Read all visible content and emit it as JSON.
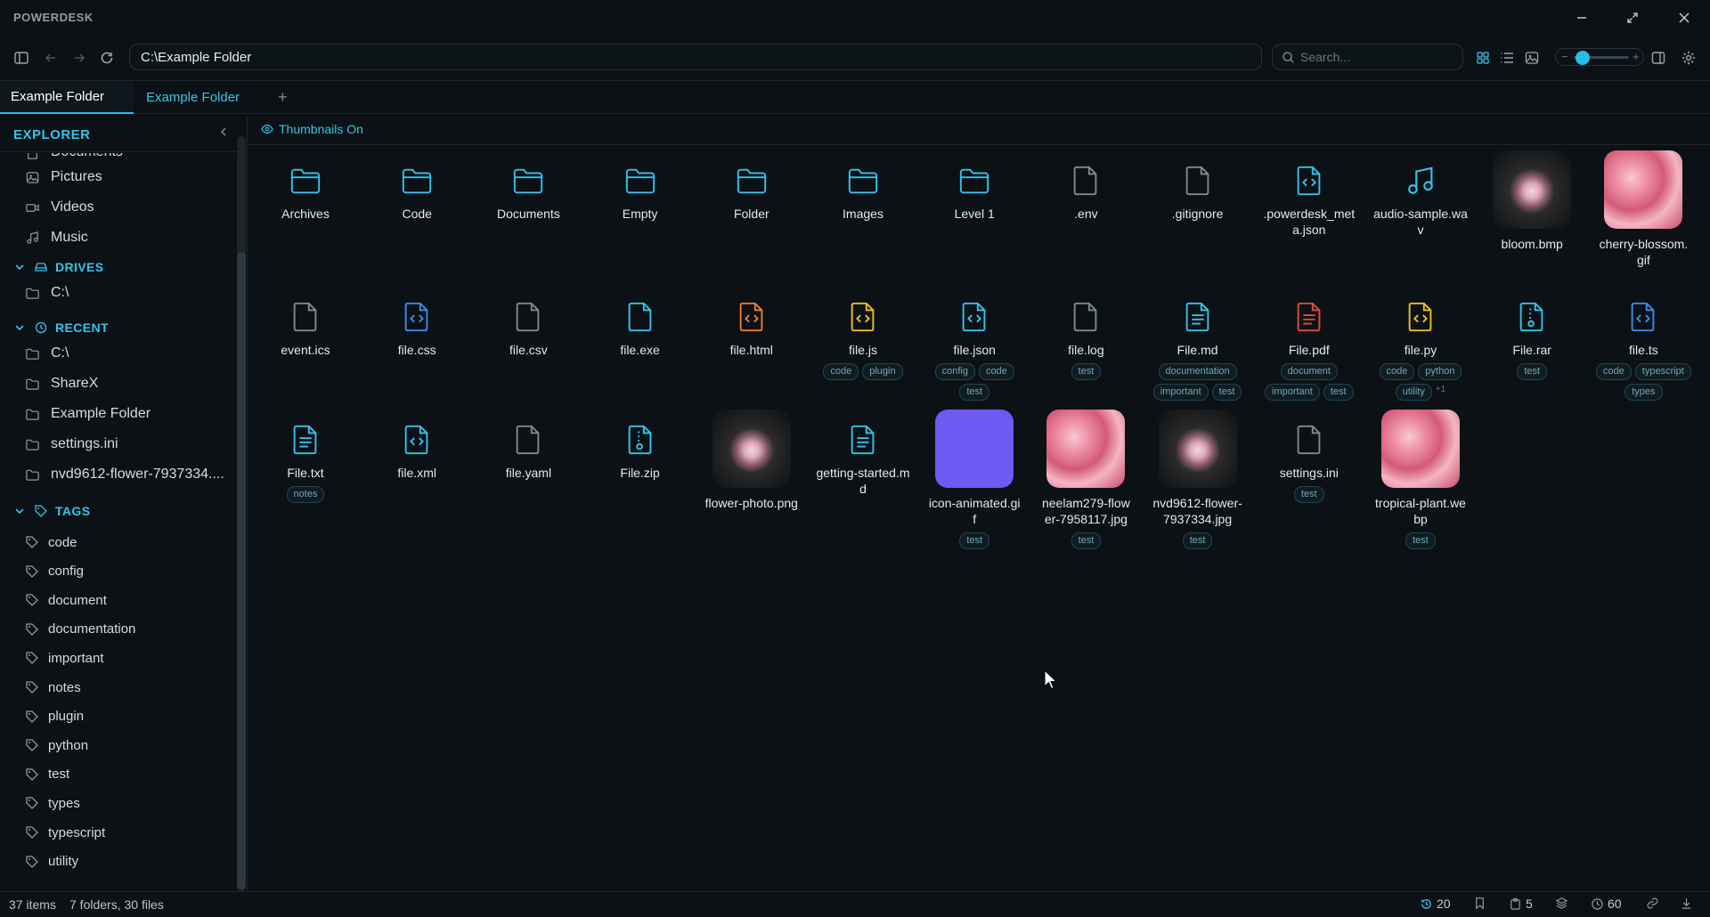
{
  "app": {
    "title": "POWERDESK"
  },
  "toolbar": {
    "address": "C:\\Example Folder",
    "search_placeholder": "Search..."
  },
  "tabs": [
    {
      "label": "Example Folder",
      "active": true
    },
    {
      "label": "Example Folder",
      "active": false
    }
  ],
  "sidebar": {
    "title": "EXPLORER",
    "partial_item": "Documents",
    "quick": [
      {
        "label": "Pictures",
        "icon": "image-icon"
      },
      {
        "label": "Videos",
        "icon": "video-icon"
      },
      {
        "label": "Music",
        "icon": "music-icon"
      }
    ],
    "drives_label": "DRIVES",
    "drives": [
      {
        "label": "C:\\"
      }
    ],
    "recent_label": "RECENT",
    "recent": [
      {
        "label": "C:\\"
      },
      {
        "label": "ShareX"
      },
      {
        "label": "Example Folder"
      },
      {
        "label": "settings.ini"
      },
      {
        "label": "nvd9612-flower-7937334...."
      }
    ],
    "tags_label": "TAGS",
    "tags": [
      "code",
      "config",
      "document",
      "documentation",
      "important",
      "notes",
      "plugin",
      "python",
      "test",
      "types",
      "typescript",
      "utility"
    ]
  },
  "main": {
    "thumbnails_label": "Thumbnails On",
    "items": [
      {
        "name": "Archives",
        "kind": "folder",
        "tags": []
      },
      {
        "name": "Code",
        "kind": "folder",
        "tags": []
      },
      {
        "name": "Documents",
        "kind": "folder",
        "tags": []
      },
      {
        "name": "Empty",
        "kind": "folder",
        "tags": []
      },
      {
        "name": "Folder",
        "kind": "folder",
        "tags": []
      },
      {
        "name": "Images",
        "kind": "folder",
        "tags": []
      },
      {
        "name": "Level 1",
        "kind": "folder",
        "tags": []
      },
      {
        "name": ".env",
        "kind": "file-gray",
        "tags": []
      },
      {
        "name": ".gitignore",
        "kind": "file-gray",
        "tags": []
      },
      {
        "name": ".powerdesk_meta.json",
        "kind": "code-cyan",
        "tags": []
      },
      {
        "name": "audio-sample.wav",
        "kind": "music",
        "tags": []
      },
      {
        "name": "bloom.bmp",
        "kind": "img-dark",
        "tags": []
      },
      {
        "name": "cherry-blossom.gif",
        "kind": "img-pink",
        "tags": []
      },
      {
        "name": "event.ics",
        "kind": "file-gray",
        "tags": []
      },
      {
        "name": "file.css",
        "kind": "code-blue",
        "tags": []
      },
      {
        "name": "file.csv",
        "kind": "file-gray",
        "tags": []
      },
      {
        "name": "file.exe",
        "kind": "file-cyan",
        "tags": []
      },
      {
        "name": "file.html",
        "kind": "code-orange",
        "tags": []
      },
      {
        "name": "file.js",
        "kind": "code-yellow",
        "tags": [
          "code",
          "plugin"
        ]
      },
      {
        "name": "file.json",
        "kind": "code-cyan",
        "tags": [
          "config",
          "code",
          "test"
        ]
      },
      {
        "name": "file.log",
        "kind": "file-gray",
        "tags": [
          "test"
        ]
      },
      {
        "name": "File.md",
        "kind": "text-cyan",
        "tags": [
          "documentation",
          "important",
          "test"
        ]
      },
      {
        "name": "File.pdf",
        "kind": "text-red",
        "tags": [
          "document",
          "important",
          "test"
        ]
      },
      {
        "name": "file.py",
        "kind": "code-yellow",
        "tags": [
          "code",
          "python",
          "utility"
        ],
        "more": "+1"
      },
      {
        "name": "File.rar",
        "kind": "zip-cyan",
        "tags": [
          "test"
        ]
      },
      {
        "name": "file.ts",
        "kind": "code-blue",
        "tags": [
          "code",
          "typescript",
          "types"
        ]
      },
      {
        "name": "File.txt",
        "kind": "text-cyan",
        "tags": [
          "notes"
        ]
      },
      {
        "name": "file.xml",
        "kind": "code-cyan",
        "tags": []
      },
      {
        "name": "file.yaml",
        "kind": "file-gray",
        "tags": []
      },
      {
        "name": "File.zip",
        "kind": "zip-cyan",
        "tags": []
      },
      {
        "name": "flower-photo.png",
        "kind": "img-dark",
        "tags": []
      },
      {
        "name": "getting-started.md",
        "kind": "text-cyan",
        "tags": []
      },
      {
        "name": "icon-animated.gif",
        "kind": "img-purple",
        "tags": [
          "test"
        ]
      },
      {
        "name": "neelam279-flower-7958117.jpg",
        "kind": "img-pink",
        "tags": [
          "test"
        ]
      },
      {
        "name": "nvd9612-flower-7937334.jpg",
        "kind": "img-dark",
        "tags": [
          "test"
        ]
      },
      {
        "name": "settings.ini",
        "kind": "file-gray",
        "tags": [
          "test"
        ]
      },
      {
        "name": "tropical-plant.webp",
        "kind": "img-pink",
        "tags": [
          "test"
        ]
      }
    ]
  },
  "status": {
    "items_count": "37 items",
    "summary": "7 folders, 30 files",
    "history_count": "20",
    "clipboard_count": "5",
    "recent_count": "60"
  },
  "colors": {
    "accent": "#22c0e8",
    "folder": "#35c4ea",
    "code_yellow": "#f0c020",
    "code_orange": "#ef7d2a",
    "pdf_red": "#e24c3d",
    "code_blue": "#3a8ee6",
    "purple": "#6f59f5"
  }
}
